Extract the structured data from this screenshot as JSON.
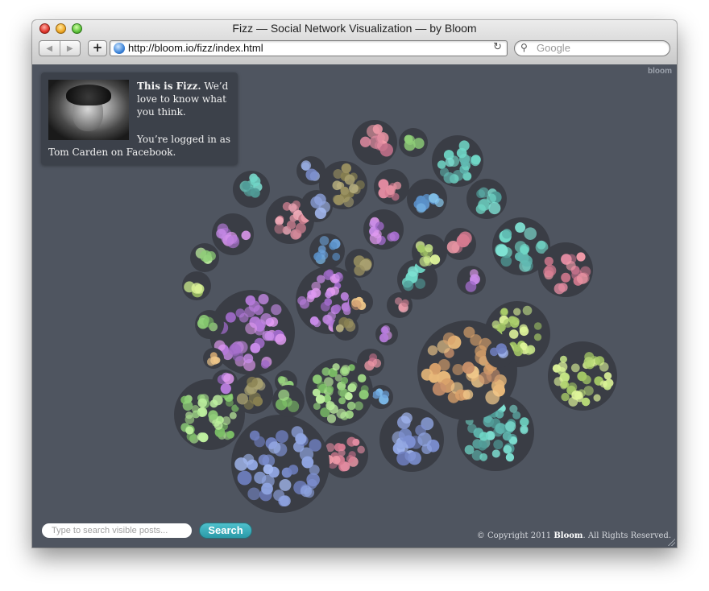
{
  "window": {
    "title": "Fizz — Social Network Visualization — by Bloom"
  },
  "toolbar": {
    "url": "http://bloom.io/fizz/index.html",
    "search_placeholder": "Google"
  },
  "brand": "bloom",
  "card": {
    "intro_bold": "This is Fizz.",
    "intro_rest": " We’d love to know what you think.",
    "logged_line1": "You’re logged in as",
    "logged_line2": "Tom Carden on Facebook."
  },
  "footer": {
    "search_placeholder": "Type to search visible posts...",
    "search_button": "Search",
    "copyright_prefix": "© Copyright 2011 ",
    "copyright_brand": "Bloom",
    "copyright_suffix": ". All Rights Reserved."
  },
  "colors": {
    "background": "#4f5560",
    "cluster": "#3a3d45",
    "accent_button": "#2b9aa8"
  }
}
